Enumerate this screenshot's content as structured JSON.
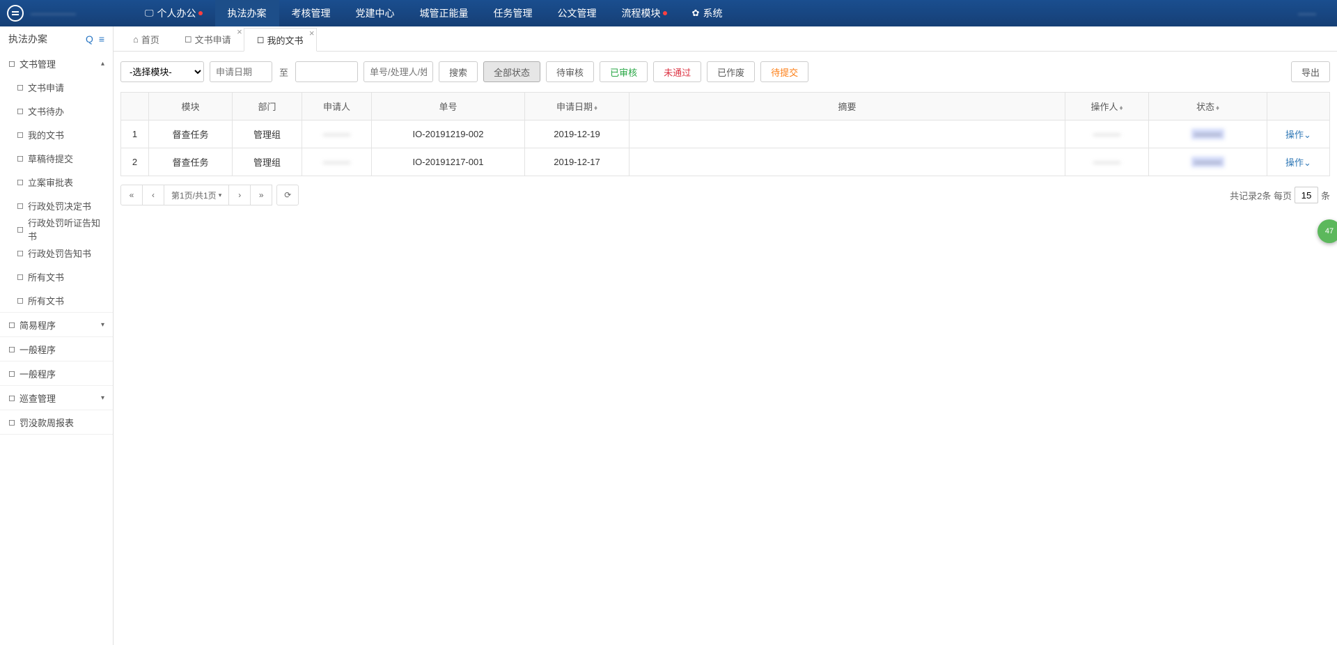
{
  "topNav": {
    "logoText": "—————",
    "items": [
      {
        "label": "个人办公",
        "icon": "monitor",
        "dot": true
      },
      {
        "label": "执法办案",
        "active": true
      },
      {
        "label": "考核管理"
      },
      {
        "label": "党建中心"
      },
      {
        "label": "城管正能量"
      },
      {
        "label": "任务管理"
      },
      {
        "label": "公文管理"
      },
      {
        "label": "流程模块",
        "dot": true
      },
      {
        "label": "系统",
        "icon": "gear"
      }
    ],
    "rightText": "——"
  },
  "sidebar": {
    "title": "执法办案",
    "groups": {
      "docMgmt": {
        "label": "文书管理",
        "expanded": true,
        "items": [
          "文书申请",
          "文书待办",
          "我的文书",
          "草稿待提交",
          "立案审批表",
          "行政处罚决定书",
          "行政处罚听证告知书",
          "行政处罚告知书",
          "所有文书",
          "所有文书"
        ]
      },
      "simple": {
        "label": "简易程序",
        "expanded": false
      },
      "general1": {
        "label": "一般程序",
        "expanded": null
      },
      "general2": {
        "label": "一般程序",
        "expanded": null
      },
      "patrol": {
        "label": "巡查管理",
        "expanded": false
      },
      "fine": {
        "label": "罚没款周报表",
        "expanded": null
      }
    }
  },
  "tabs": [
    {
      "label": "首页",
      "icon": "home"
    },
    {
      "label": "文书申请",
      "icon": "bookmark",
      "closable": true
    },
    {
      "label": "我的文书",
      "icon": "bookmark",
      "closable": true,
      "active": true
    }
  ],
  "filters": {
    "moduleSelect": "-选择模块-",
    "dateFromPlaceholder": "申请日期",
    "toLabel": "至",
    "searchPlaceholder": "单号/处理人/姓名",
    "searchBtn": "搜索",
    "statusButtons": [
      "全部状态",
      "待审核",
      "已审核",
      "未通过",
      "已作废",
      "待提交"
    ],
    "activeStatus": "全部状态",
    "exportBtn": "导出"
  },
  "table": {
    "headers": [
      "",
      "模块",
      "部门",
      "申请人",
      "单号",
      "申请日期",
      "摘要",
      "操作人",
      "状态",
      ""
    ],
    "sortable": {
      "5": true,
      "7": true,
      "8": true
    },
    "rows": [
      {
        "idx": "1",
        "module": "督查任务",
        "dept": "管理组",
        "applicant": "———",
        "docno": "IO-20191219-002",
        "date": "2019-12-19",
        "summary": "",
        "operator": "———",
        "status": "———",
        "action": "操作"
      },
      {
        "idx": "2",
        "module": "督查任务",
        "dept": "管理组",
        "applicant": "———",
        "docno": "IO-20191217-001",
        "date": "2019-12-17",
        "summary": "",
        "operator": "———",
        "status": "———",
        "action": "操作"
      }
    ]
  },
  "pagination": {
    "first": "«",
    "prev": "‹",
    "current": "第1页/共1页",
    "next": "›",
    "last": "»",
    "refresh": "↻",
    "totalLabel": "共记录2条   每页",
    "pageSize": "15",
    "unit": "条"
  },
  "floatBadge": "47"
}
